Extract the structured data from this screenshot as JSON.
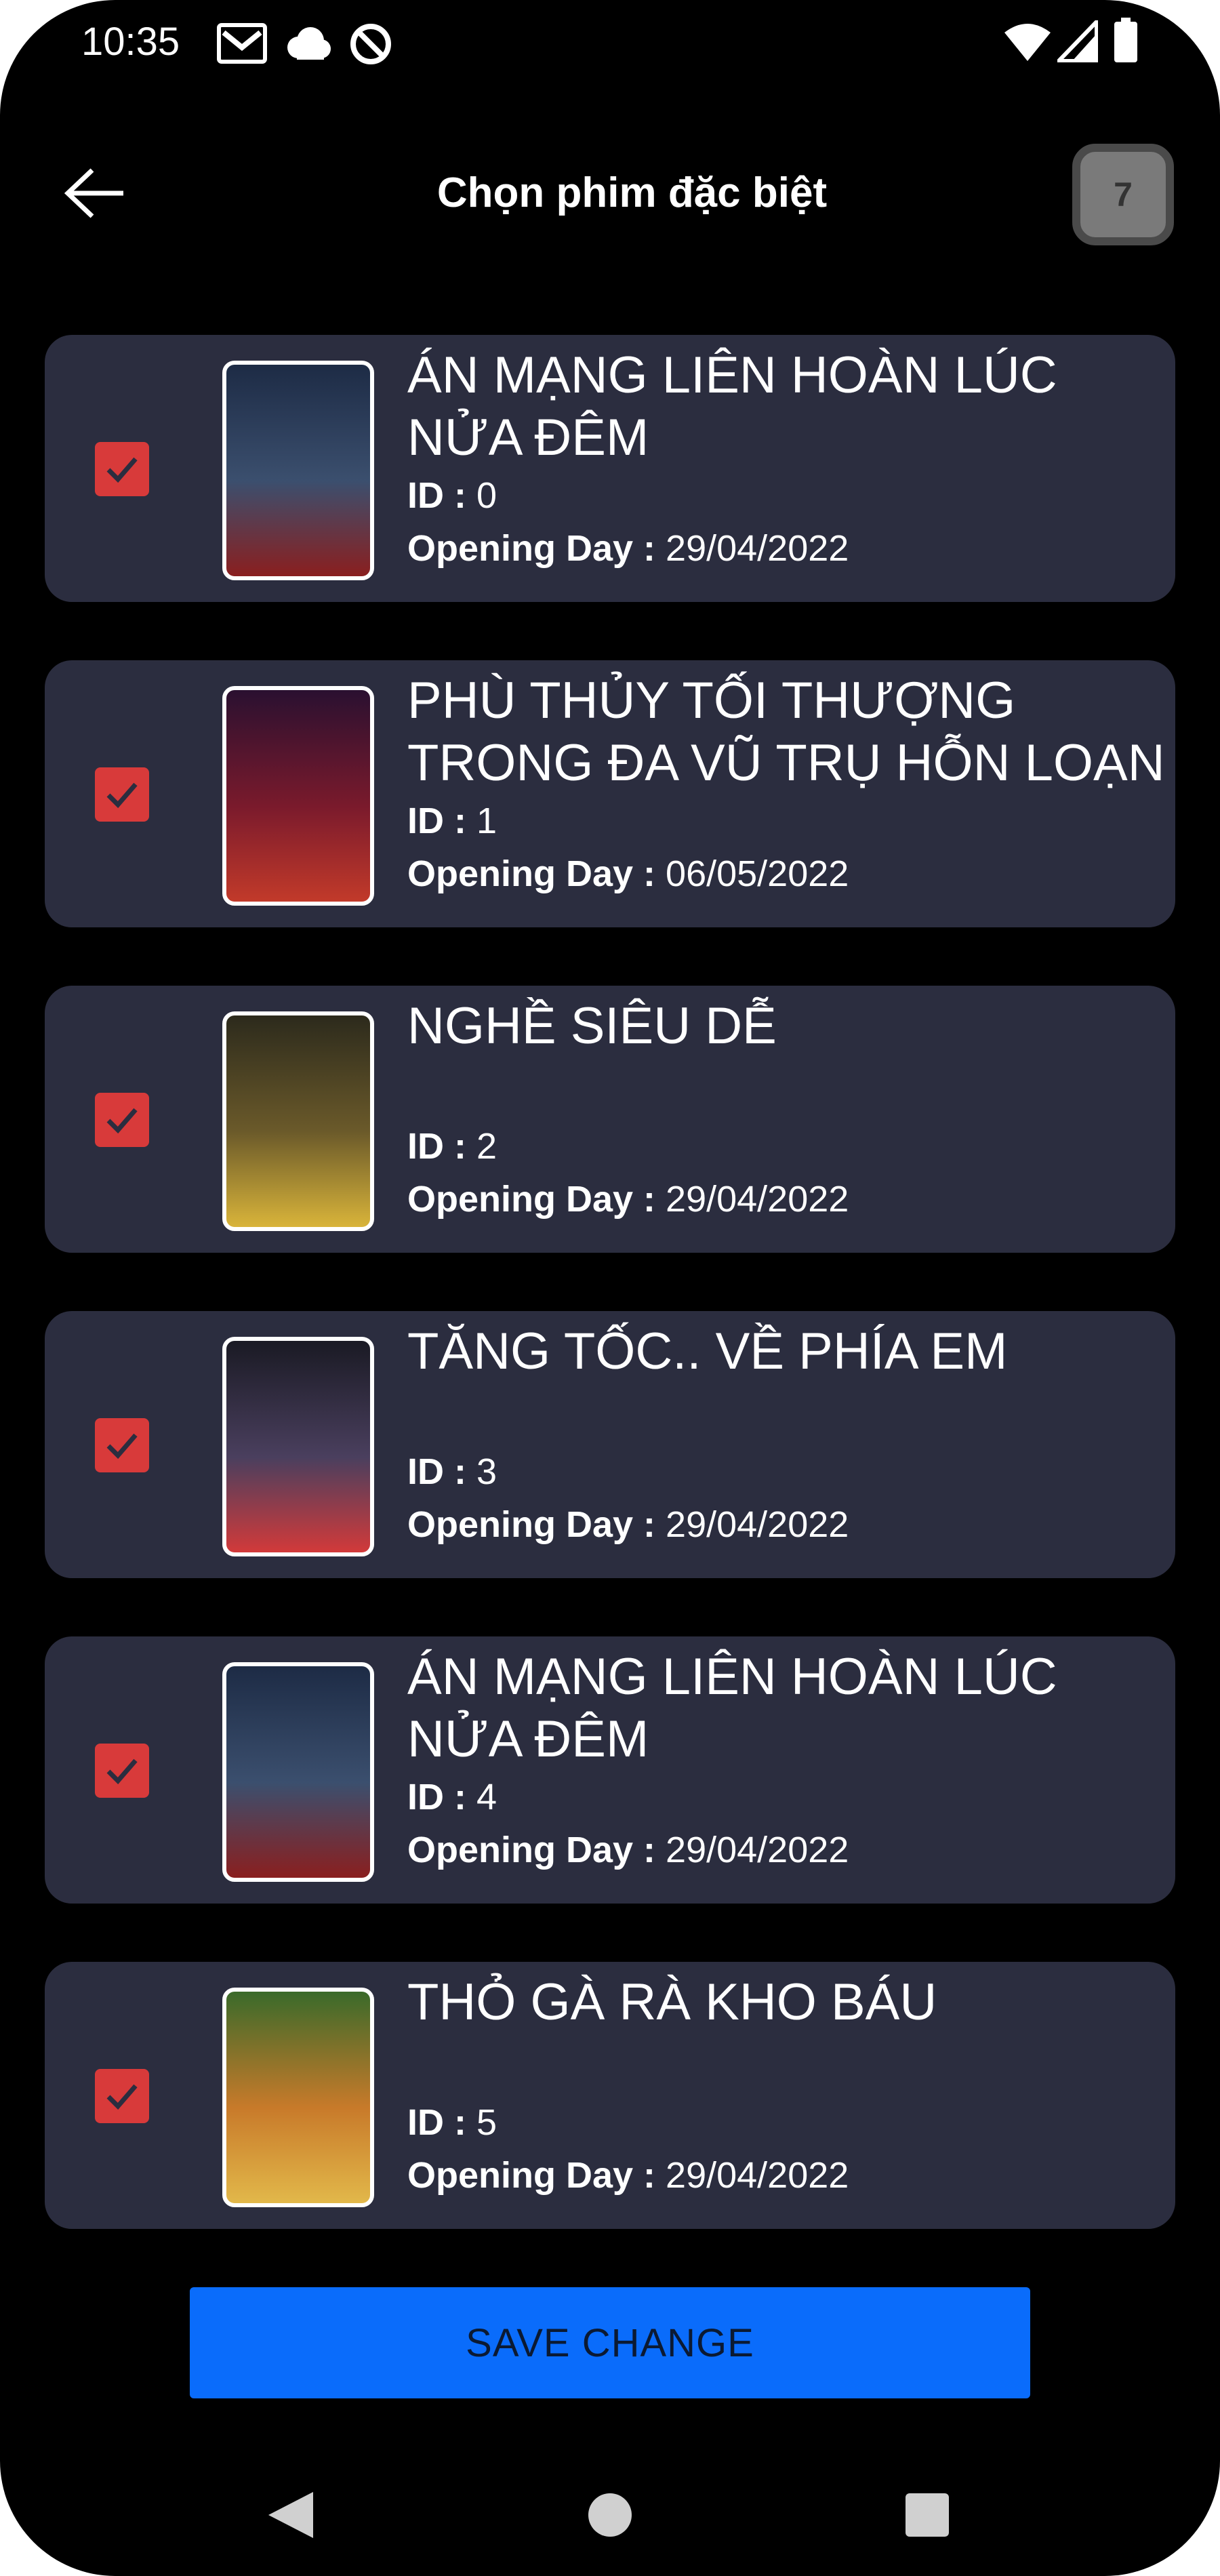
{
  "status_bar": {
    "time": "10:35",
    "left_icons": [
      "gmail-icon",
      "cloud-icon",
      "sync-icon"
    ],
    "right_icons": [
      "wifi-icon",
      "signal-icon",
      "battery-icon"
    ]
  },
  "header": {
    "title": "Chọn phim đặc biệt",
    "selected_count": "7"
  },
  "movies": [
    {
      "title": "ÁN MẠNG LIÊN HOÀN LÚC NỬA ĐÊM",
      "id_label": "ID : ",
      "id": "0",
      "opening_label": "Opening Day : ",
      "opening_day": "29/04/2022",
      "checked": true,
      "poster_colors": [
        "#1d2b45",
        "#3b4f6e",
        "#8a1f1f"
      ]
    },
    {
      "title": "PHÙ THỦY TỐI THƯỢNG TRONG ĐA VŨ TRỤ HỖN LOẠN",
      "id_label": "ID : ",
      "id": "1",
      "opening_label": "Opening Day : ",
      "opening_day": "06/05/2022",
      "checked": true,
      "poster_colors": [
        "#2a1030",
        "#7a1a2c",
        "#c23a2a"
      ]
    },
    {
      "title": "NGHỀ SIÊU DỄ",
      "id_label": "ID : ",
      "id": "2",
      "opening_label": "Opening Day : ",
      "opening_day": "29/04/2022",
      "checked": true,
      "poster_colors": [
        "#2c2a1c",
        "#6b5a2a",
        "#d9b43a"
      ]
    },
    {
      "title": "TĂNG TỐC.. VỀ PHÍA EM",
      "id_label": "ID : ",
      "id": "3",
      "opening_label": "Opening Day : ",
      "opening_day": "29/04/2022",
      "checked": true,
      "poster_colors": [
        "#1a1a24",
        "#4a3f5e",
        "#d23a3a"
      ]
    },
    {
      "title": "ÁN MẠNG LIÊN HOÀN LÚC NỬA ĐÊM",
      "id_label": "ID : ",
      "id": "4",
      "opening_label": "Opening Day : ",
      "opening_day": "29/04/2022",
      "checked": true,
      "poster_colors": [
        "#1d2b45",
        "#3b4f6e",
        "#8a1f1f"
      ]
    },
    {
      "title": "THỎ GÀ RÀ KHO BÁU",
      "id_label": "ID : ",
      "id": "5",
      "opening_label": "Opening Day : ",
      "opening_day": "29/04/2022",
      "checked": true,
      "poster_colors": [
        "#3a6a2a",
        "#c87a2a",
        "#e2b84a"
      ]
    }
  ],
  "save_button": {
    "label": "SAVE CHANGE"
  },
  "nav_bar": {
    "icons": [
      "back-triangle-icon",
      "home-circle-icon",
      "recents-square-icon"
    ]
  },
  "colors": {
    "background": "#000000",
    "card": "#2b2d3f",
    "checkbox": "#d83a3a",
    "save_button": "#0a6cfb",
    "badge": "#7a7a7a"
  }
}
